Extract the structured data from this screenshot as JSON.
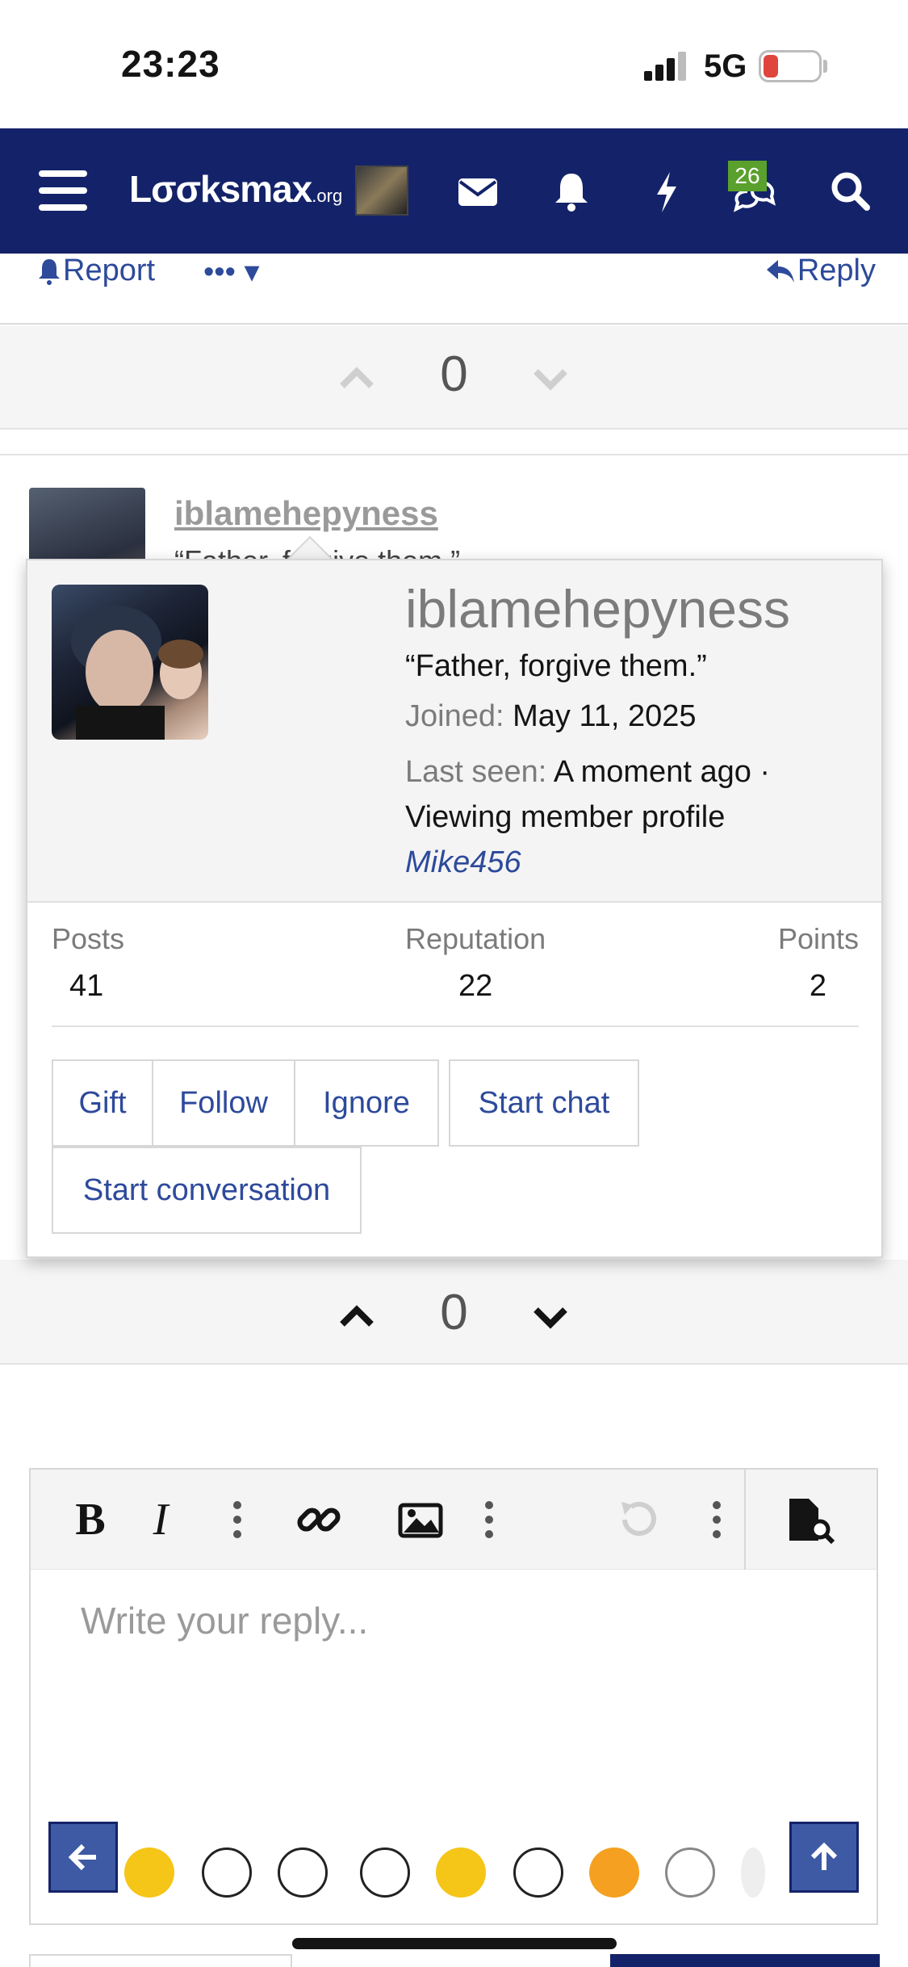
{
  "status_bar": {
    "time": "23:23",
    "network": "5G",
    "battery": "10"
  },
  "navbar": {
    "logo_main": "Lσσksmax",
    "logo_suffix": ".org",
    "alerts_badge": "26"
  },
  "post_actions": {
    "report": "Report",
    "more": "•••",
    "reply": "Reply"
  },
  "votes": {
    "top_count": "0",
    "bottom_count": "0"
  },
  "comment": {
    "username": "iblamehepyness",
    "title_partial": "“Father, forgive them.”"
  },
  "profile_popup": {
    "username": "iblamehepyness",
    "user_title": "“Father, forgive them.”",
    "joined_label": "Joined:",
    "joined_value": "May 11, 2025",
    "last_seen_label": "Last seen:",
    "last_seen_value": "A moment ago ·",
    "activity": "Viewing member profile",
    "activity_link": "Mike456",
    "stats": [
      {
        "label": "Posts",
        "value": "41"
      },
      {
        "label": "Reputation",
        "value": "22"
      },
      {
        "label": "Points",
        "value": "2"
      }
    ],
    "buttons": {
      "gift": "Gift",
      "follow": "Follow",
      "ignore": "Ignore",
      "start_chat": "Start chat",
      "start_conversation": "Start conversation"
    }
  },
  "editor": {
    "placeholder": "Write your reply..."
  },
  "colors": {
    "navbar": "#142369",
    "link": "#2d4a9b",
    "badge": "#5aa02c",
    "battery_low": "#e0453d"
  }
}
